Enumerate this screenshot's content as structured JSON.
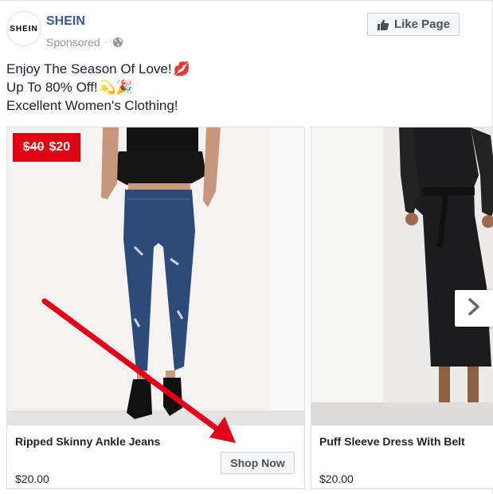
{
  "advertiser": {
    "logo_text": "SHEIN",
    "name": "SHEIN",
    "sponsored": "Sponsored",
    "separator": "·"
  },
  "like_button": {
    "label": "Like Page",
    "icon": "thumbs-up-icon"
  },
  "post_text": {
    "line1": "Enjoy The Season Of Love!",
    "line1_emoji": "💋",
    "line2": "Up To 80% Off!",
    "line2_emoji": "💫🎉",
    "line3": "Excellent Women's Clothing!"
  },
  "carousel": {
    "cards": [
      {
        "title": "Ripped Skinny Ankle Jeans",
        "price": "$20.00",
        "cta": "Shop Now",
        "badge_old_price": "$40",
        "badge_new_price": "$20"
      },
      {
        "title": "Puff Sleeve Dress With Belt",
        "price": "$20.00"
      }
    ],
    "next_icon": "chevron-right-icon"
  },
  "colors": {
    "brand_link": "#385898",
    "badge_red": "#e0000f",
    "annotation_red": "#e3001b"
  }
}
